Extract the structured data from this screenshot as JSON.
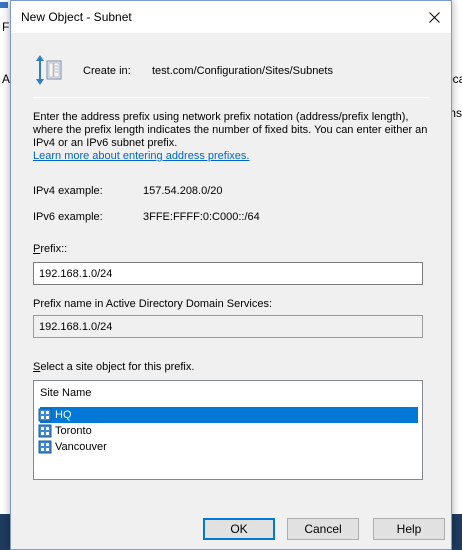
{
  "background": {
    "top_letters": [
      "F"
    ],
    "left_letters": [
      "A"
    ],
    "right_letters": [
      "oca",
      "ms"
    ]
  },
  "dialog": {
    "title": "New Object - Subnet",
    "create_in_label": "Create in:",
    "create_in_path": "test.com/Configuration/Sites/Subnets",
    "description": "Enter the address prefix using network prefix notation (address/prefix length), where the prefix length indicates the number of fixed bits. You can enter either an IPv4 or an IPv6 subnet prefix.",
    "learn_more_link": "Learn more about entering address prefixes.",
    "ipv4_example_label": "IPv4 example:",
    "ipv4_example_value": "157.54.208.0/20",
    "ipv6_example_label": "IPv6 example:",
    "ipv6_example_value": "3FFE:FFFF:0:C000::/64",
    "prefix_label_accel": "P",
    "prefix_label_rest": "refix::",
    "prefix_value": "192.168.1.0/24",
    "prefix_name_label": "Prefix name in Active Directory Domain Services:",
    "prefix_name_value": "192.168.1.0/24",
    "site_label_accel": "S",
    "site_label_rest": "elect a site object for this prefix.",
    "site_list": {
      "header": "Site Name",
      "items": [
        {
          "name": "HQ",
          "selected": true
        },
        {
          "name": "Toronto",
          "selected": false
        },
        {
          "name": "Vancouver",
          "selected": false
        }
      ]
    },
    "buttons": {
      "ok": "OK",
      "cancel": "Cancel",
      "help": "Help"
    }
  },
  "colors": {
    "selection": "#0078d7",
    "link": "#0066cc",
    "dialog_bg": "#f0f0f0"
  },
  "icons": {
    "title_close": "close-icon",
    "create_in": "subnet-object-icon",
    "site": "site-icon"
  }
}
